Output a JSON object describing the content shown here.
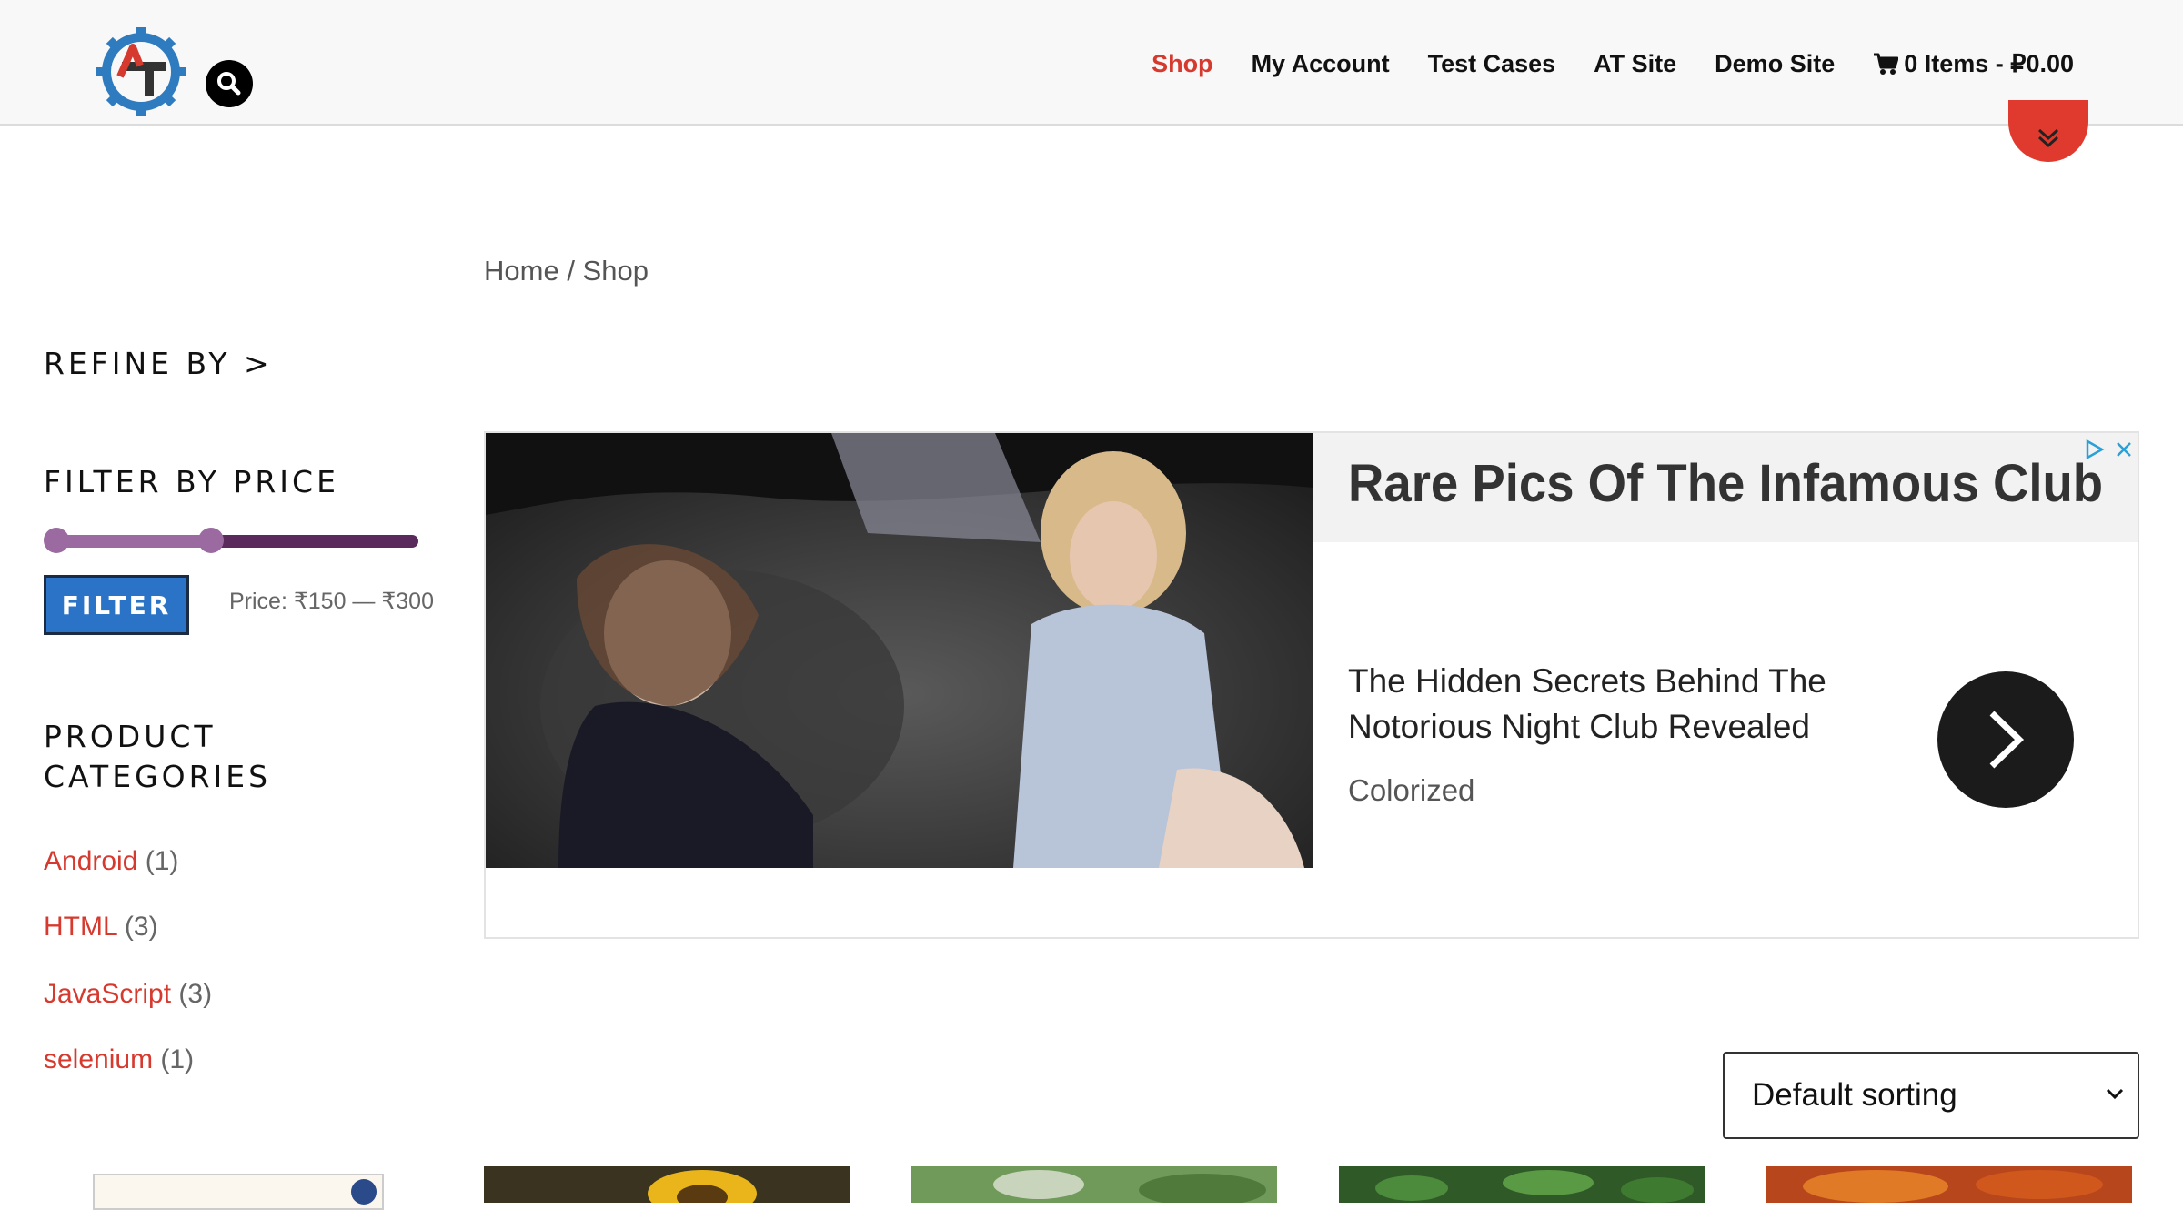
{
  "header": {
    "nav": [
      {
        "label": "Shop",
        "active": true
      },
      {
        "label": "My Account",
        "active": false
      },
      {
        "label": "Test Cases",
        "active": false
      },
      {
        "label": "AT Site",
        "active": false
      },
      {
        "label": "Demo Site",
        "active": false
      }
    ],
    "cart_label": "0 Items - ₽0.00",
    "icons": {
      "search": "search-icon",
      "cart": "cart-icon",
      "scroll": "chevron-double-down-icon"
    }
  },
  "breadcrumb": {
    "home": "Home",
    "separator": " / ",
    "current": "Shop"
  },
  "sidebar": {
    "refine_title": "REFINE BY >",
    "price_filter": {
      "title": "FILTER BY PRICE",
      "button_label": "FILTER",
      "price_text": "Price: ₹150 — ₹300",
      "range_selected_fraction": [
        0.0,
        0.43
      ]
    },
    "categories_title_line1": "PRODUCT",
    "categories_title_line2": "CATEGORIES",
    "categories": [
      {
        "name": "Android",
        "count": "(1)"
      },
      {
        "name": "HTML",
        "count": "(3)"
      },
      {
        "name": "JavaScript",
        "count": "(3)"
      },
      {
        "name": "selenium",
        "count": "(1)"
      }
    ]
  },
  "ad": {
    "headline": "Rare Pics Of The Infamous Club",
    "description": "The Hidden Secrets Behind The Notorious Night Club Revealed",
    "source": "Colorized",
    "icons": {
      "cta": "chevron-right-icon",
      "choices": "ad-choices-icon",
      "close": "close-icon"
    }
  },
  "sorting": {
    "selected": "Default sorting"
  },
  "colors": {
    "accent": "#d63a2f",
    "filter_button": "#2a73c6",
    "slider_track": "#5a2a5c",
    "slider_range": "#9a6aa0",
    "scroll_button": "#e03a2e"
  }
}
